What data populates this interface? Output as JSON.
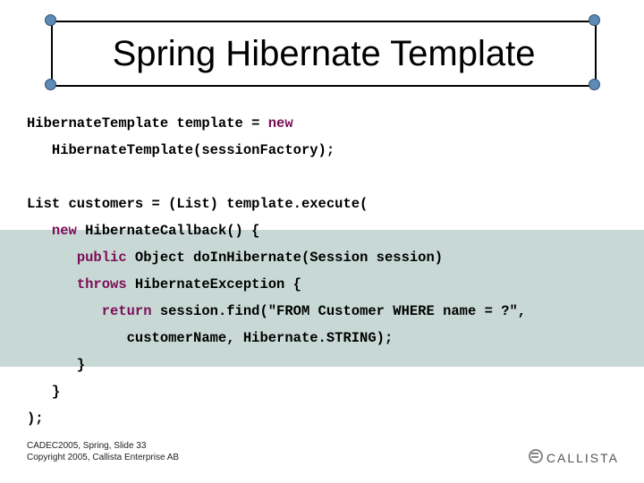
{
  "title": "Spring Hibernate Template",
  "code": {
    "blank": " ",
    "kw_new": "new",
    "kw_public": "public",
    "kw_throws": "throws",
    "kw_return": "return",
    "l1a": "HibernateTemplate template = ",
    "l2": "   HibernateTemplate(sessionFactory);",
    "l3": "List customers = (List) template.execute(",
    "l4a": "   ",
    "l4b": " HibernateCallback() {",
    "l5a": "      ",
    "l5b": " Object doInHibernate(Session session)",
    "l6a": "      ",
    "l6b": " HibernateException {",
    "l7a": "         ",
    "l7b": " session.find(\"FROM Customer WHERE name = ?\",",
    "l8": "            customerName, Hibernate.STRING);",
    "l9": "      }",
    "l10": "   }",
    "l11": ");"
  },
  "footer": {
    "line1": "CADEC2005, Spring, Slide 33",
    "line2": "Copyright 2005, Callista Enterprise AB"
  },
  "logo": {
    "text": "CALLISTA"
  }
}
